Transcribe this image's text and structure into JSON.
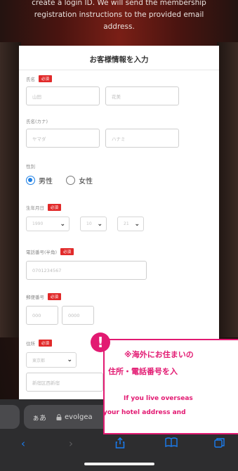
{
  "intro": {
    "line1": "create a login ID. We will send the membership",
    "line2": "registration instructions to the provided email",
    "line3": "address."
  },
  "form": {
    "title": "お客様情報を入力",
    "required_badge": "必須",
    "name": {
      "label": "氏名",
      "last": "山田",
      "first": "花美"
    },
    "kana": {
      "label": "氏名(カナ)",
      "last": "ヤマダ",
      "first": "ハナミ"
    },
    "gender": {
      "label": "性別",
      "options": [
        "男性",
        "女性"
      ],
      "selected": "男性"
    },
    "birth": {
      "label": "生年月日",
      "year": "1990",
      "month": "10",
      "day": "21"
    },
    "phone": {
      "label": "電話番号(半角)",
      "value": "0701234567"
    },
    "zip": {
      "label": "郵便番号",
      "first": "000",
      "second": "0000"
    },
    "address": {
      "label": "住所",
      "prefecture": "東京都",
      "city": "新宿区西新宿"
    }
  },
  "browser": {
    "aa_label": "ぁあ",
    "url": "evolgea",
    "colors": {
      "accent": "#1a7df0"
    }
  },
  "notice": {
    "jp_line1": "※海外にお住まいの",
    "jp_line2": "住所・電話番号を入",
    "en_line1": "If you live overseas",
    "en_line2": "your hotel address and",
    "badge": "!",
    "color": "#e21a72"
  }
}
